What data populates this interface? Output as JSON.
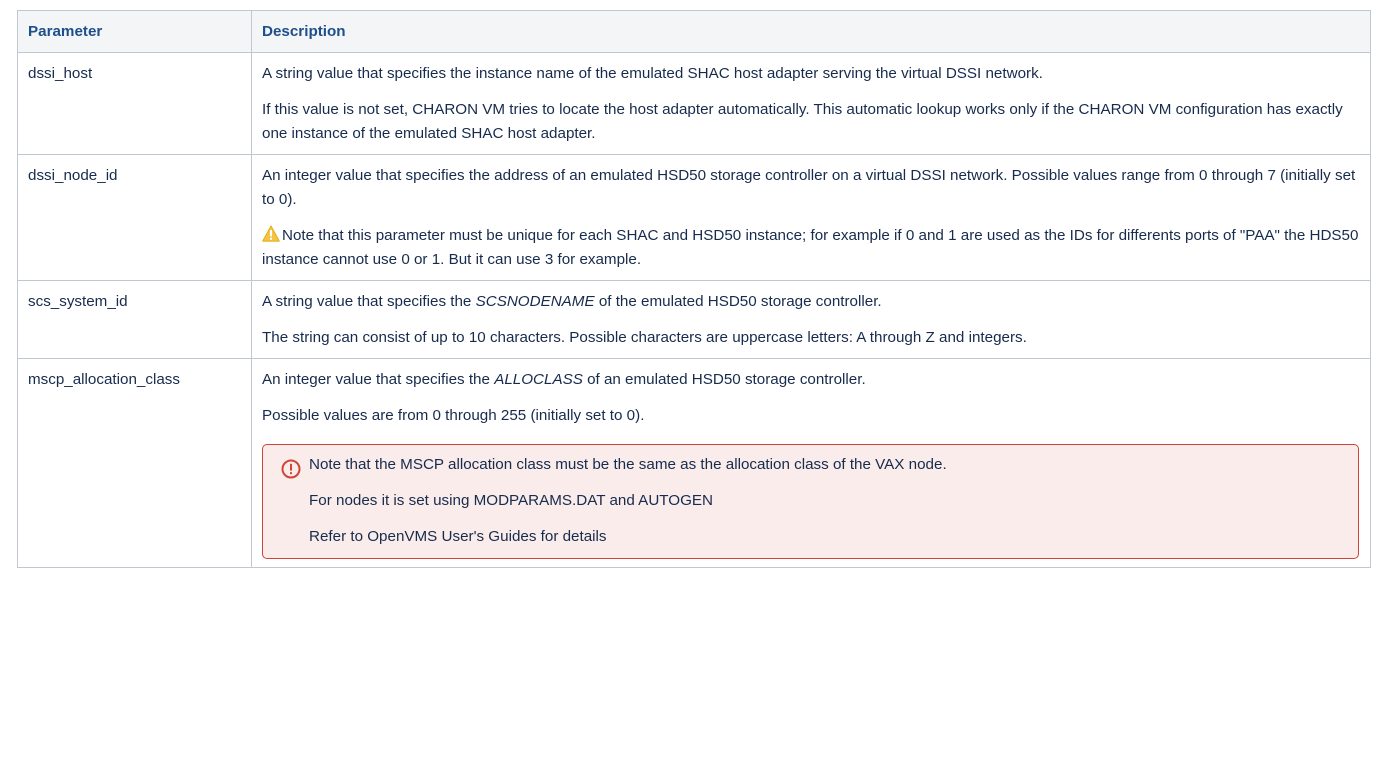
{
  "table": {
    "headers": {
      "parameter": "Parameter",
      "description": "Description"
    },
    "rows": {
      "dssi_host": {
        "name": "dssi_host",
        "p1": "A string value that specifies the instance name of the emulated SHAC host adapter serving the virtual DSSI network.",
        "p2": "If this value is not set, CHARON VM tries to locate the host adapter automatically. This automatic lookup works only if the CHARON VM configuration has exactly one instance of the emulated SHAC host adapter."
      },
      "dssi_node_id": {
        "name": "dssi_node_id",
        "p1": "An integer value that specifies the address of an emulated HSD50 storage controller on a virtual DSSI network. Possible values range from 0 through 7 (initially set to 0).",
        "note": "Note that this parameter must be unique for each SHAC and HSD50 instance; for example if 0 and 1 are used as the IDs for differents ports of \"PAA\" the HDS50 instance cannot use 0 or 1. But it can use 3 for example."
      },
      "scs_system_id": {
        "name": "scs_system_id",
        "p1_before": "A string value that specifies the ",
        "p1_em": "SCSNODENAME",
        "p1_after": " of the emulated HSD50 storage controller.",
        "p2": "The string can consist of up to 10 characters. Possible characters are uppercase letters: A through Z and integers."
      },
      "mscp_allocation_class": {
        "name": "mscp_allocation_class",
        "p1_before": "An integer value that specifies the ",
        "p1_em": "ALLOCLASS",
        "p1_after": " of an emulated HSD50 storage controller.",
        "p2": "Possible values are from 0 through 255 (initially set to 0).",
        "panel": {
          "line1": "Note that the MSCP allocation class must be the same as the allocation class of the VAX node.",
          "line2": "For nodes it is set using MODPARAMS.DAT and AUTOGEN",
          "line3": "Refer to OpenVMS User's Guides for details"
        }
      }
    }
  },
  "icons": {
    "warning": "warning-triangle-icon",
    "error": "exclamation-circle-icon"
  },
  "colors": {
    "header_text": "#1d4f8a",
    "header_bg": "#f4f5f7",
    "border": "#c1c7d0",
    "panel_border": "#d04437",
    "panel_bg": "#f9ecea",
    "warning_fill": "#f6c342"
  }
}
